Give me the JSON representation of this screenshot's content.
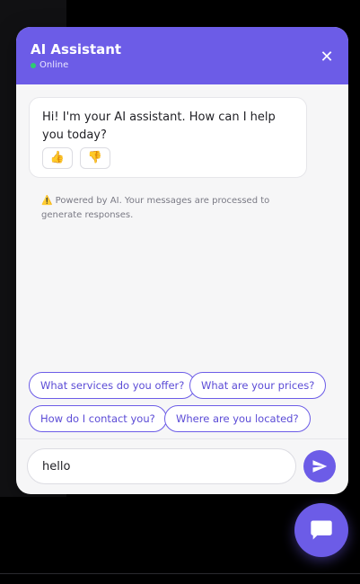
{
  "header": {
    "title": "AI Assistant",
    "status": "Online",
    "close_glyph": "✕",
    "close_icon": "close-icon"
  },
  "messages": [
    {
      "from": "assistant",
      "text": "Hi! I'm your AI assistant. How can I help you today?",
      "feedback": {
        "up_glyph": "👍",
        "down_glyph": "👎"
      }
    }
  ],
  "disclaimer": {
    "icon_glyph": "⚠️",
    "text": "Powered by AI. Your messages are processed to generate responses."
  },
  "suggestions": [
    "What services do you offer?",
    "What are your prices?",
    "How do I contact you?",
    "Where are you located?"
  ],
  "composer": {
    "value": "hello",
    "send_icon": "send-icon"
  },
  "launcher": {
    "icon": "chat-bubble-icon"
  },
  "colors": {
    "accent": "#6c5ce7",
    "online": "#2ecc71",
    "panel": "#f6f6f7"
  }
}
